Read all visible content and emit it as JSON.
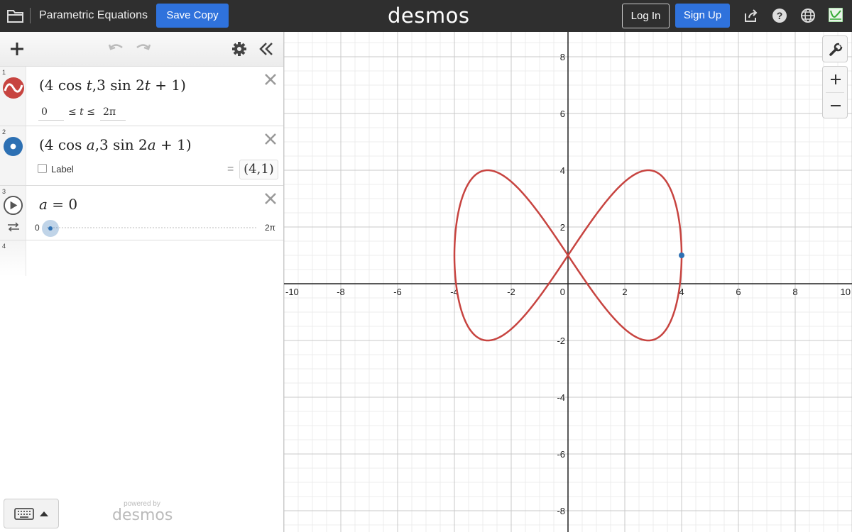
{
  "topbar": {
    "title": "Parametric Equations",
    "save_copy": "Save Copy",
    "brand": "desmos",
    "login": "Log In",
    "signup": "Sign Up",
    "icons": [
      "folder-icon",
      "share-icon",
      "help-icon",
      "globe-icon",
      "graph-thumbnail-icon"
    ]
  },
  "expressions": [
    {
      "index": "1",
      "latex": "(4 cos t, 3 sin 2t + 1)",
      "parts": [
        "(4 cos ",
        "t",
        ",3 sin 2",
        "t",
        " + 1)"
      ],
      "domain_min": "0",
      "domain_op": "≤ t ≤",
      "domain_max": "2π",
      "color": "#c74440"
    },
    {
      "index": "2",
      "parts": [
        "(4 cos ",
        "a",
        ",3 sin 2",
        "a",
        " + 1)"
      ],
      "label_text": "Label",
      "eq_sign": "=",
      "value": "(4,1)",
      "color": "#2d70b3"
    },
    {
      "index": "3",
      "var": "a",
      "eq": " = 0",
      "slider_min": "0",
      "slider_max": "2π",
      "slider_value": 0
    },
    {
      "index": "4"
    }
  ],
  "footer": {
    "powered_by": "powered by",
    "brand": "desmos"
  },
  "graph": {
    "x_ticks": [
      "-10",
      "-8",
      "-6",
      "-4",
      "-2",
      "0",
      "2",
      "4",
      "6",
      "8",
      "10"
    ],
    "y_ticks": [
      "8",
      "6",
      "4",
      "2",
      "-2",
      "-4",
      "-6",
      "-8"
    ],
    "xlim": [
      -10,
      10
    ],
    "ylim": [
      -8.75,
      8.875
    ],
    "curve_color": "#c74440",
    "point_color": "#2d70b3",
    "point": [
      4,
      1
    ]
  }
}
